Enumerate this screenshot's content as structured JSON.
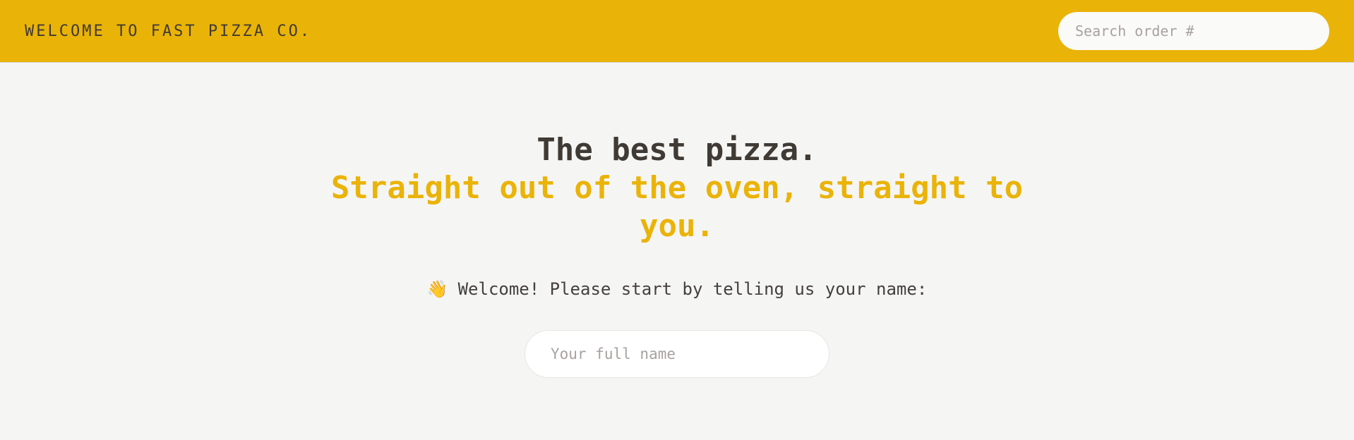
{
  "header": {
    "brand": "WELCOME TO FAST PIZZA CO.",
    "search_placeholder": "Search order #"
  },
  "hero": {
    "line1": "The best pizza.",
    "line2": "Straight out of the oven, straight to you."
  },
  "welcome": {
    "emoji": "👋",
    "text": "Welcome! Please start by telling us your name:"
  },
  "form": {
    "name_placeholder": "Your full name",
    "name_value": ""
  },
  "colors": {
    "accent": "#eab308",
    "background": "#f5f5f4",
    "text": "#44403c"
  }
}
